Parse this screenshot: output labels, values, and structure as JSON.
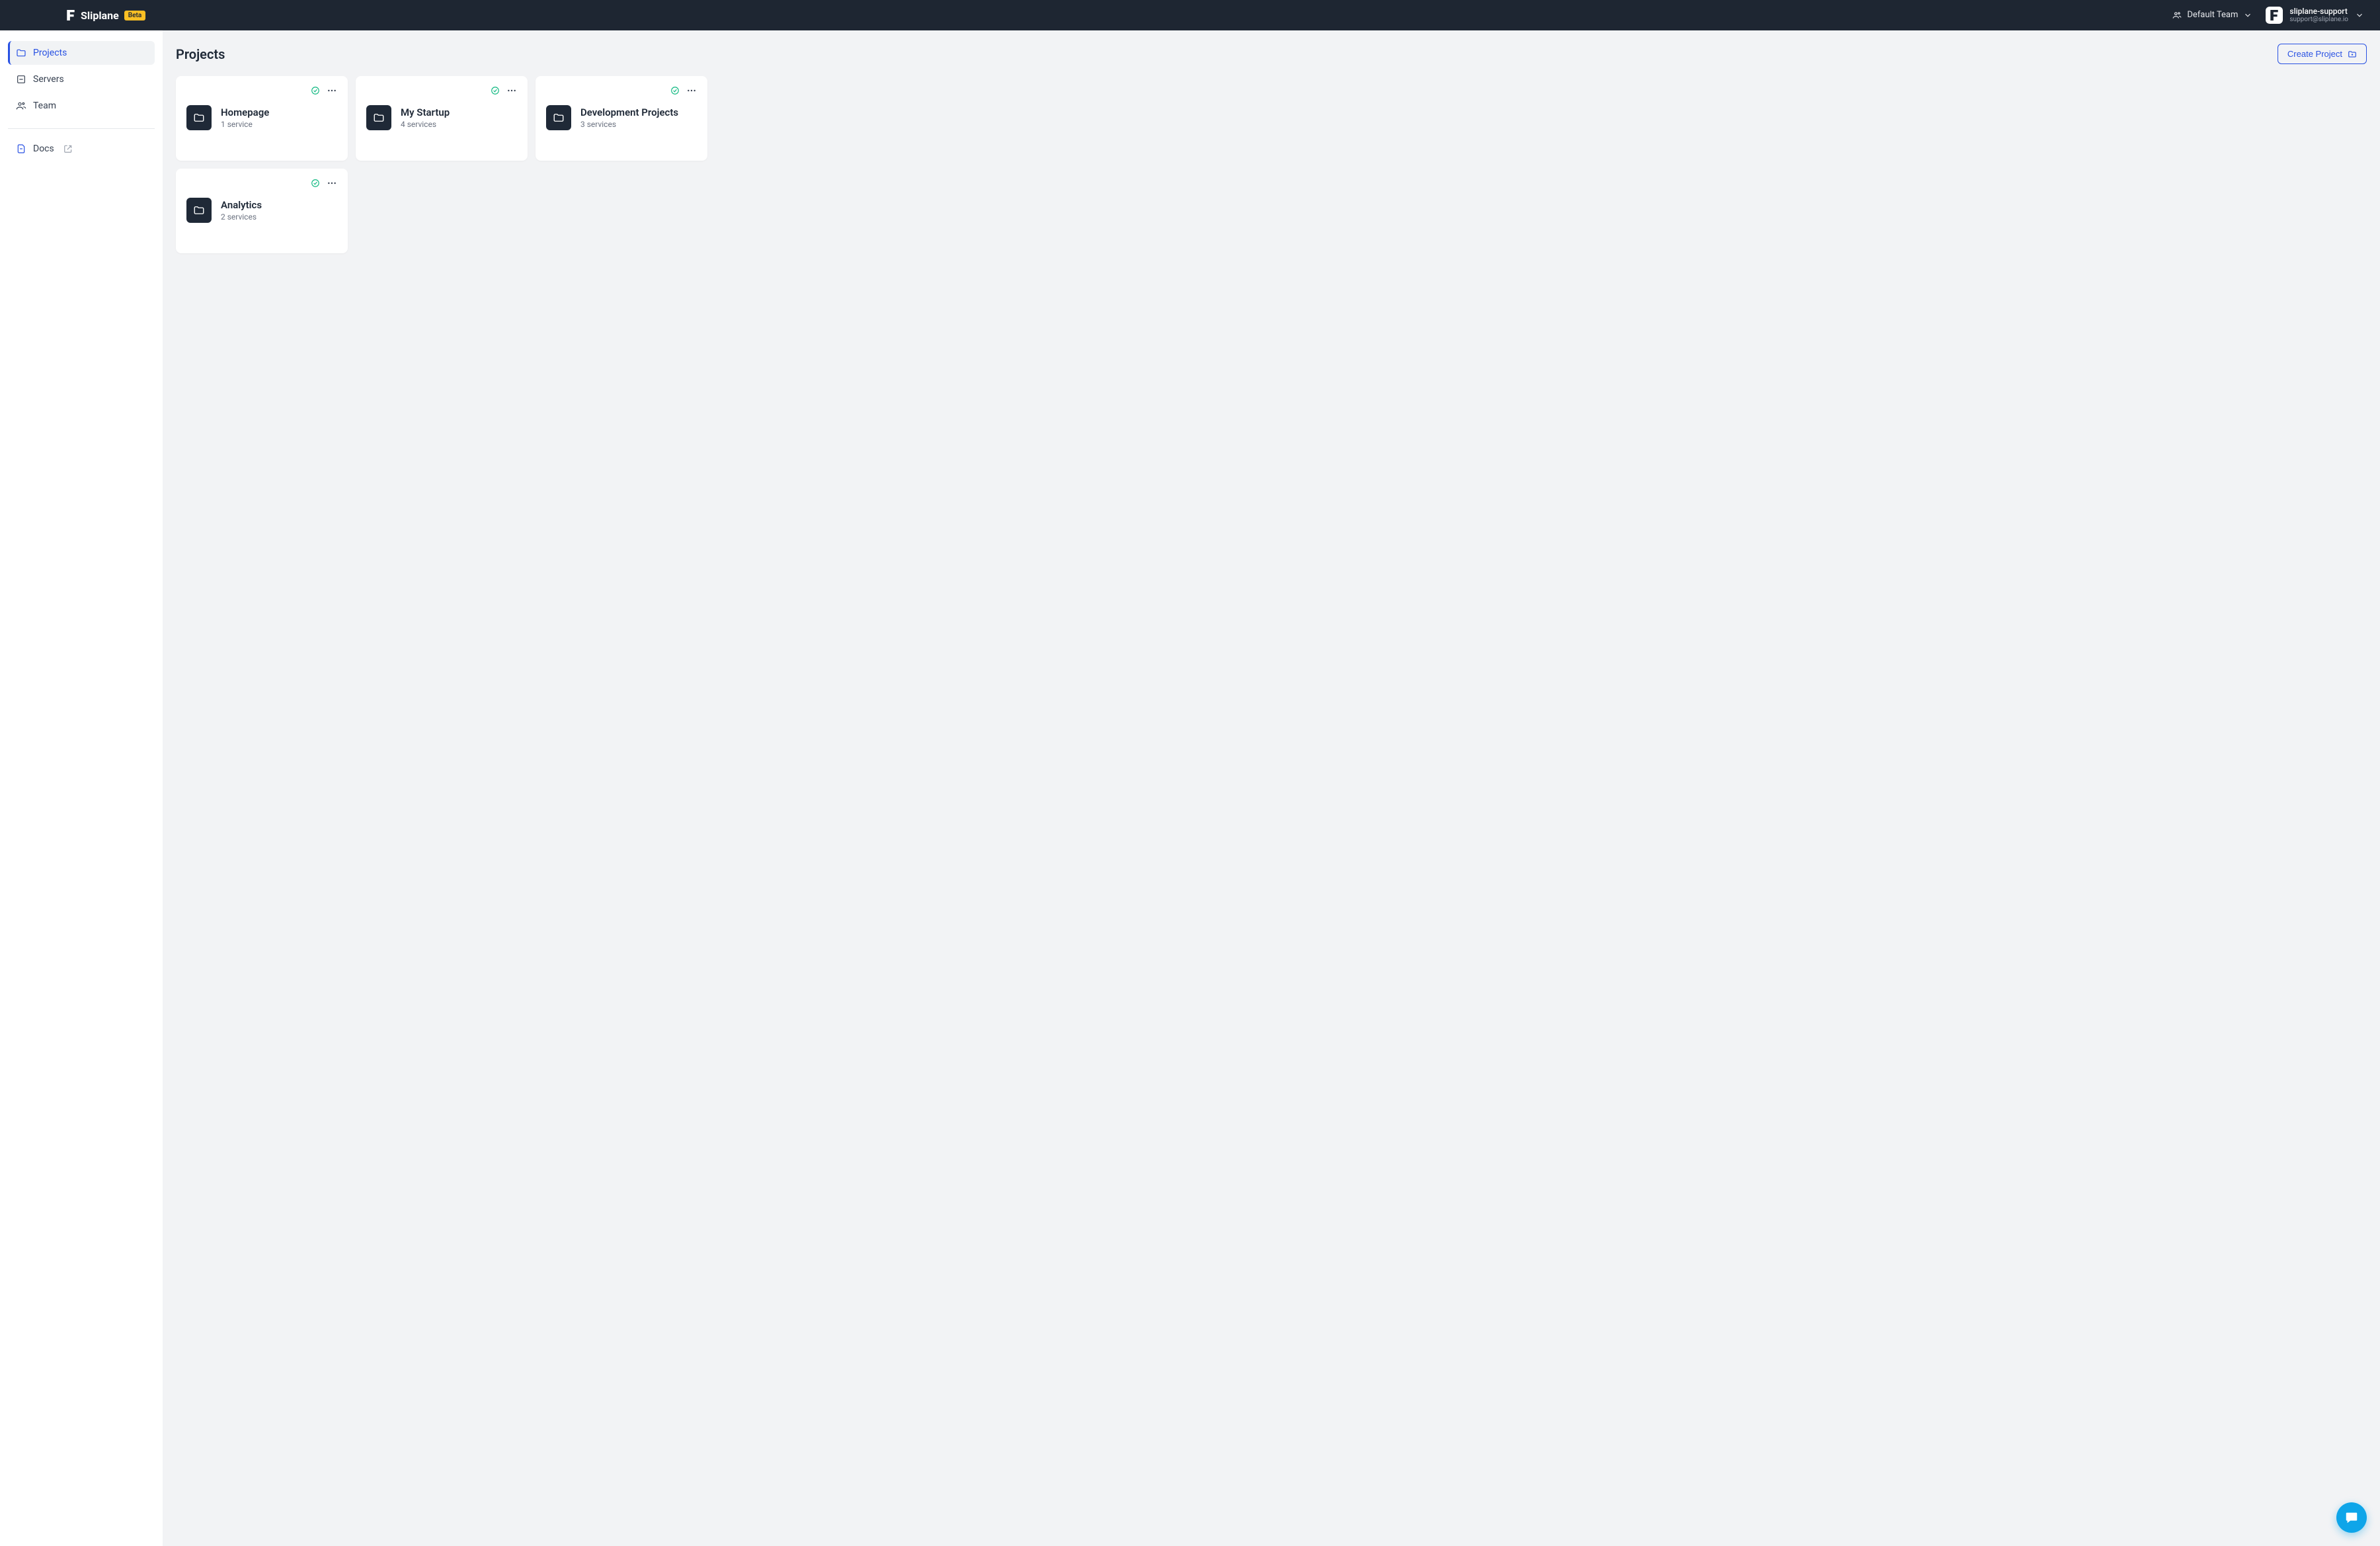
{
  "header": {
    "brand": "Sliplane",
    "badge": "Beta",
    "team_label": "Default Team",
    "user_name": "sliplane-support",
    "user_email": "support@sliplane.io"
  },
  "sidebar": {
    "items": [
      {
        "label": "Projects"
      },
      {
        "label": "Servers"
      },
      {
        "label": "Team"
      }
    ],
    "docs_label": "Docs"
  },
  "page": {
    "title": "Projects",
    "create_label": "Create Project"
  },
  "projects": [
    {
      "name": "Homepage",
      "meta": "1 service"
    },
    {
      "name": "My Startup",
      "meta": "4 services"
    },
    {
      "name": "Development Projects",
      "meta": "3 services"
    },
    {
      "name": "Analytics",
      "meta": "2 services"
    }
  ]
}
